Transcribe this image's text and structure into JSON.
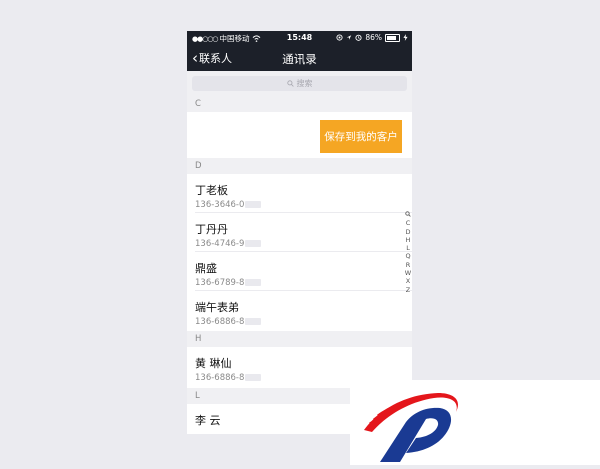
{
  "status_bar": {
    "carrier": "中国移动",
    "time": "15:48",
    "battery_percent": "86%"
  },
  "nav": {
    "back_label": "联系人",
    "title": "通讯录"
  },
  "search": {
    "placeholder": "搜索"
  },
  "sections": [
    {
      "letter": "C"
    },
    {
      "letter": "D"
    },
    {
      "letter": "H"
    },
    {
      "letter": "L"
    }
  ],
  "swipe_action": {
    "label": "保存到我的客户",
    "color": "#f5a623"
  },
  "contacts": [
    {
      "name": "丁老板",
      "phone": "136-3646-0"
    },
    {
      "name": "丁丹丹",
      "phone": "136-4746-9"
    },
    {
      "name": "鼎盛",
      "phone": "136-6789-8"
    },
    {
      "name": "端午表弟",
      "phone": "136-6886-8"
    },
    {
      "name": "黄 琳仙",
      "phone": "136-6886-8"
    },
    {
      "name": "李 云",
      "phone": ""
    }
  ],
  "index_letters": [
    "Q",
    "C",
    "D",
    "H",
    "L",
    "Q",
    "R",
    "W",
    "X",
    "Z"
  ]
}
